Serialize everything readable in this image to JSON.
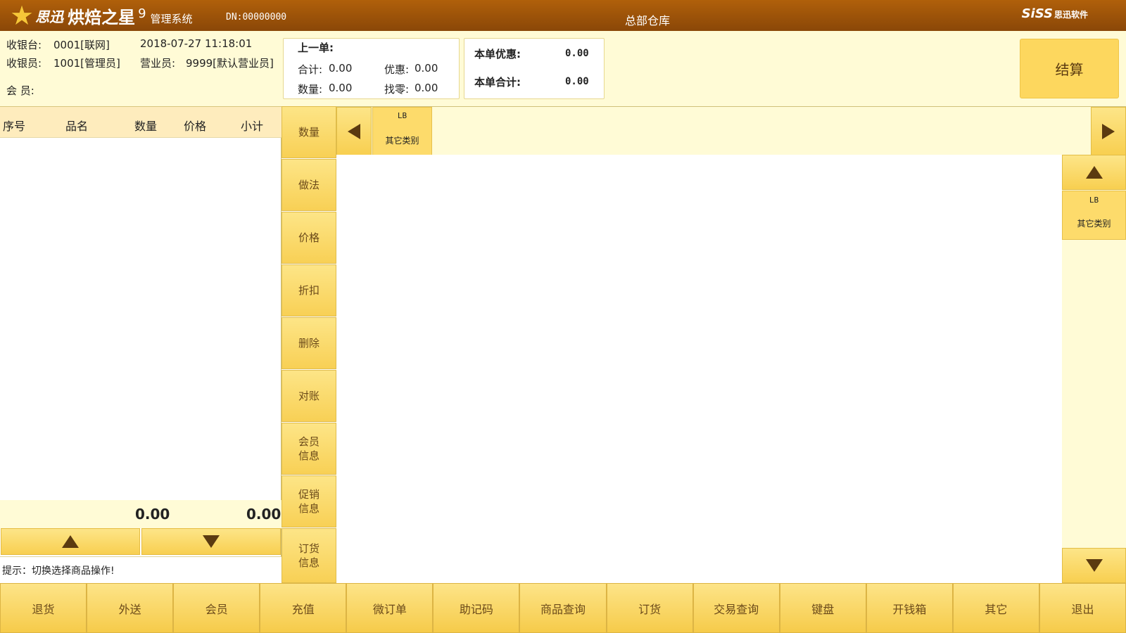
{
  "header": {
    "brand": "思迅",
    "product": "烘焙之星",
    "version": "9",
    "system": "管理系统",
    "dn": "DN:00000000",
    "warehouse": "总部仓库",
    "vendor": "SiSS",
    "vendor_cn": "思迅软件"
  },
  "info": {
    "register_label": "收银台:",
    "register_value": "0001[联网]",
    "datetime": "2018-07-27 11:18:01",
    "cashier_label": "收银员:",
    "cashier_value": "1001[管理员]",
    "salesperson_label": "营业员:",
    "salesperson_value": "9999[默认营业员]",
    "member_label": "会 员:"
  },
  "last_order": {
    "title": "上一单:",
    "total_label": "合计:",
    "total_value": "0.00",
    "discount_label": "优惠:",
    "discount_value": "0.00",
    "qty_label": "数量:",
    "qty_value": "0.00",
    "change_label": "找零:",
    "change_value": "0.00"
  },
  "current_order": {
    "discount_label": "本单优惠:",
    "discount_value": "0.00",
    "total_label": "本单合计:",
    "total_value": "0.00"
  },
  "checkout_label": "结算",
  "table": {
    "columns": [
      "序号",
      "品名",
      "数量",
      "价格",
      "小计"
    ],
    "total_qty": "0.00",
    "total_subtotal": "0.00",
    "hint": "提示：切换选择商品操作!"
  },
  "functions": [
    {
      "label": "数量"
    },
    {
      "label": "做法"
    },
    {
      "label": "价格"
    },
    {
      "label": "折扣"
    },
    {
      "label": "删除"
    },
    {
      "label": "对账"
    },
    {
      "label": "会员\n信息"
    },
    {
      "label": "促销\n信息"
    },
    {
      "label": "订货\n信息"
    }
  ],
  "category": {
    "code": "LB",
    "name": "其它类别"
  },
  "subcategory": {
    "code": "LB",
    "name": "其它类别"
  },
  "bottom": [
    {
      "label": "退货"
    },
    {
      "label": "外送"
    },
    {
      "label": "会员"
    },
    {
      "label": "充值"
    },
    {
      "label": "微订单"
    },
    {
      "label": "助记码"
    },
    {
      "label": "商品查询"
    },
    {
      "label": "订货"
    },
    {
      "label": "交易查询"
    },
    {
      "label": "键盘"
    },
    {
      "label": "开钱箱"
    },
    {
      "label": "其它"
    },
    {
      "label": "退出"
    }
  ]
}
